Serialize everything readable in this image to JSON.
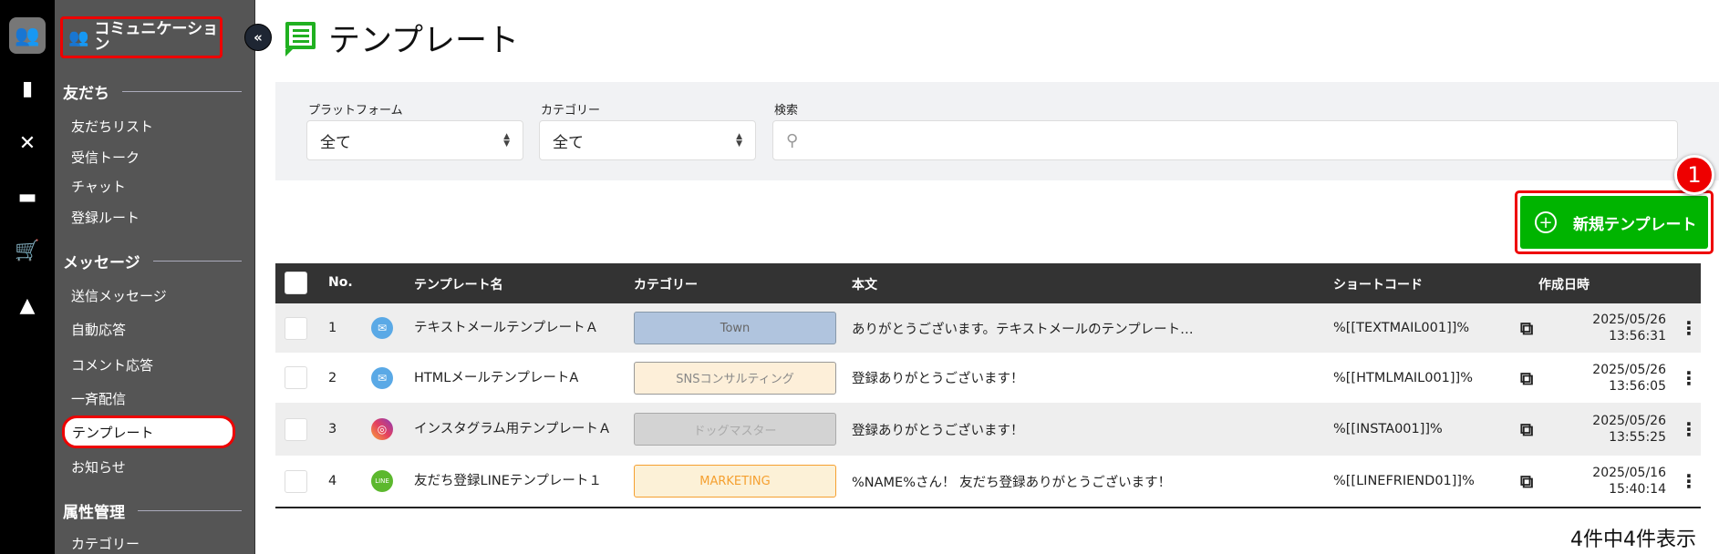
{
  "rail": {
    "icons": [
      "users-icon",
      "chart-icon",
      "tools-icon",
      "folder-icon",
      "cart-icon",
      "image-icon"
    ]
  },
  "sidebar": {
    "header": "コミュニケーション",
    "sections": [
      {
        "title": "友だち",
        "items": [
          "友だちリスト",
          "受信トーク",
          "チャット",
          "登録ルート"
        ]
      },
      {
        "title": "メッセージ",
        "items": [
          "送信メッセージ",
          "自動応答",
          "コメント応答",
          "一斉配信",
          "テンプレート",
          "お知らせ"
        ]
      },
      {
        "title": "属性管理",
        "items": [
          "カテゴリー"
        ]
      }
    ],
    "active": "テンプレート"
  },
  "page": {
    "title": "テンプレート",
    "collapse": "«"
  },
  "filters": {
    "platform_label": "プラットフォーム",
    "platform_value": "全て",
    "category_label": "カテゴリー",
    "category_value": "全て",
    "search_label": "検索",
    "search_value": ""
  },
  "new_button": {
    "label": "新規テンプレート",
    "badge": "1"
  },
  "table": {
    "headers": {
      "no": "No.",
      "name": "テンプレート名",
      "category": "カテゴリー",
      "body": "本文",
      "shortcode": "ショートコード",
      "created": "作成日時"
    },
    "rows": [
      {
        "no": "1",
        "channel": "email",
        "name": "テキストメールテンプレートＡ",
        "category": "Town",
        "cat_bg": "#b0c4de",
        "cat_fg": "#666",
        "cat_border": "#8899aa",
        "body": "ありがとうございます。テキストメールのテンプレート…",
        "shortcode": "%[[TEXTMAIL001]]%",
        "date": "2025/05/26",
        "time": "13:56:31"
      },
      {
        "no": "2",
        "channel": "email",
        "name": "HTMLメールテンプレートA",
        "category": "SNSコンサルティング",
        "cat_bg": "#fdefd9",
        "cat_fg": "#888",
        "cat_border": "#999",
        "body": "登録ありがとうございます！",
        "shortcode": "%[[HTMLMAIL001]]%",
        "date": "2025/05/26",
        "time": "13:56:05"
      },
      {
        "no": "3",
        "channel": "instagram",
        "name": "インスタグラム用テンプレートＡ",
        "category": "ドッグマスター",
        "cat_bg": "#d3d3d3",
        "cat_fg": "#aaa",
        "cat_border": "#aaa",
        "body": "登録ありがとうございます！",
        "shortcode": "%[[INSTA001]]%",
        "date": "2025/05/26",
        "time": "13:55:25"
      },
      {
        "no": "4",
        "channel": "line",
        "name": "友だち登録LINEテンプレート１",
        "category": "MARKETING",
        "cat_bg": "#fcf1d7",
        "cat_fg": "#f5a030",
        "cat_border": "#f5a030",
        "body": "%NAME%さん！ 友だち登録ありがとうございます！",
        "shortcode": "%[[LINEFRIEND01]]%",
        "date": "2025/05/16",
        "time": "15:40:14"
      }
    ]
  },
  "footer": {
    "count": "4件中4件表示"
  },
  "colors": {
    "accent_green": "#00b400",
    "highlight_red": "#e00000",
    "sidebar": "#555555",
    "table_header": "#333333"
  }
}
